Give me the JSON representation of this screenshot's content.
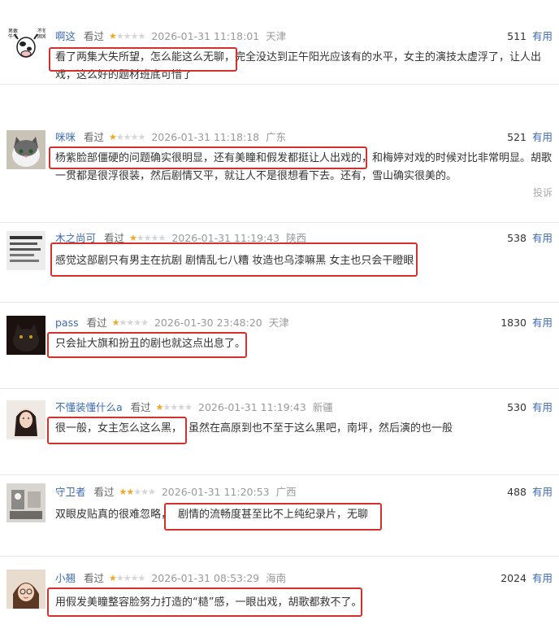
{
  "useful_label": "有用",
  "watched_label": "看过",
  "comments": [
    {
      "user": "啊这",
      "status": "看过",
      "stars": 1,
      "time": "2026-01-31 11:18:01",
      "location": "天津",
      "votes": "511",
      "useful": "有用",
      "highlight": "看了两集大失所望，怎么能这么无聊，",
      "rest": "完全没达到正午阳光应该有的水平，女主的演技太虚浮了，让人出戏，这么好的题材班底可惜了",
      "avatar_text": "男敢牛牛",
      "avatar_text2": "不怕困难"
    },
    {
      "user": "咪咪",
      "status": "看过",
      "stars": 1,
      "time": "2026-01-31 11:18:18",
      "location": "广东",
      "votes": "521",
      "useful": "有用",
      "highlight": "杨紫脸部僵硬的问题确实很明显，还有美瞳和假发都挺让人出戏的，",
      "rest": "和梅婷对戏的时候对比非常明显。胡歌一贯都是很浮很装，然后剧情又平，就让人不是很想看下去。还有，雪山确实很美的。",
      "report": "投诉"
    },
    {
      "user": "木之尚可",
      "status": "看过",
      "stars": 1,
      "time": "2026-01-31 11:19:43",
      "location": "陕西",
      "votes": "538",
      "useful": "有用",
      "highlight": "感觉这部剧只有男主在抗剧 剧情乱七八糟 妆造也乌漆嘛黑 女主也只会干瞪眼",
      "rest": ""
    },
    {
      "user": "pass",
      "status": "看过",
      "stars": 1,
      "time": "2026-01-30 23:48:20",
      "location": "天津",
      "votes": "1830",
      "useful": "有用",
      "highlight": "只会扯大旗和扮丑的剧也就这点出息了。",
      "rest": ""
    },
    {
      "user": "不懂装懂什么a",
      "status": "看过",
      "stars": 1,
      "time": "2026-01-31 11:19:43",
      "location": "新疆",
      "votes": "530",
      "useful": "有用",
      "highlight": "很一般，女主怎么这么黑，",
      "rest": "虽然在高原到也不至于这么黑吧，南坪，然后演的也一般"
    },
    {
      "user": "守卫者",
      "status": "看过",
      "stars": 2,
      "time": "2026-01-31 11:20:53",
      "location": "广西",
      "votes": "488",
      "useful": "有用",
      "prefix": "双眼皮贴真的很难忽略，",
      "highlight": "剧情的流畅度甚至比不上纯纪录片，无聊",
      "rest": ""
    },
    {
      "user": "小翘",
      "status": "看过",
      "stars": 1,
      "time": "2026-01-31 08:53:29",
      "location": "海南",
      "votes": "2024",
      "useful": "有用",
      "highlight": "用假发美瞳整容脸努力打造的“糙”感，一眼出戏，胡歌都救不了。",
      "rest": ""
    }
  ],
  "colors": {
    "highlight_border": "#d4312c",
    "username": "#3d6bb3",
    "star_on": "#f5a623",
    "star_off": "#d6d6d6"
  }
}
